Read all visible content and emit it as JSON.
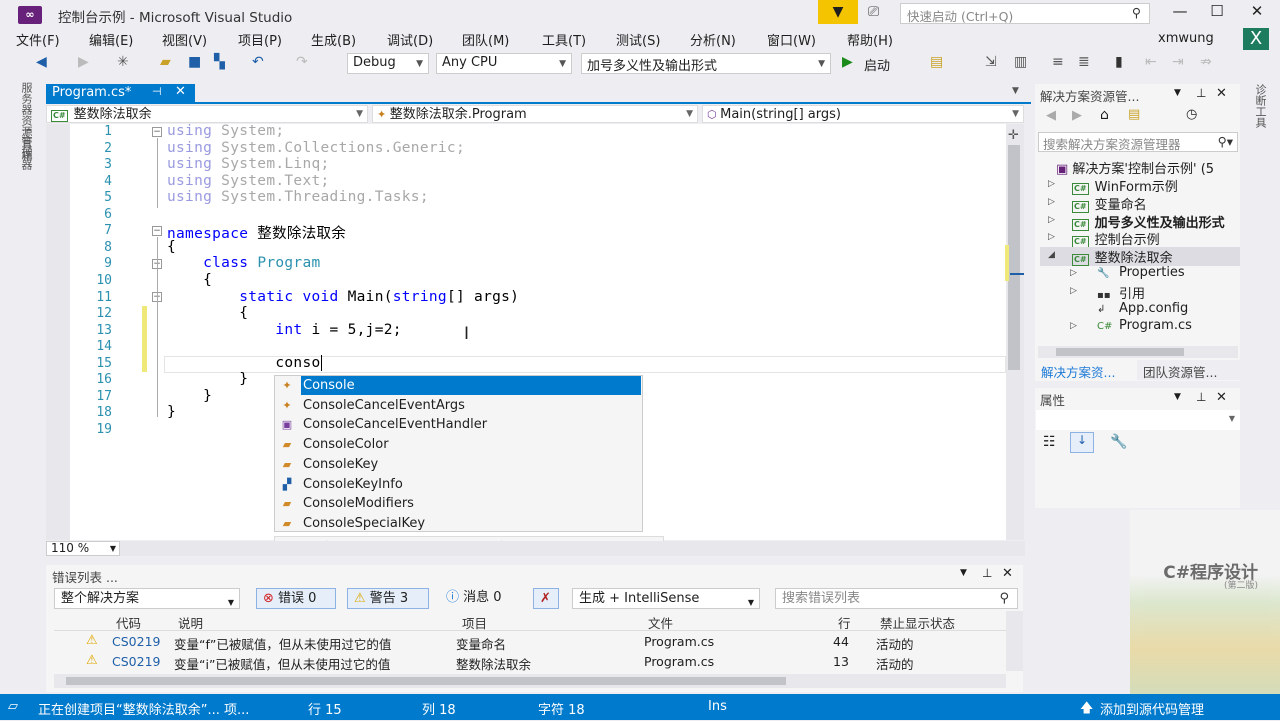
{
  "window": {
    "title": "控制台示例 - Microsoft Visual Studio",
    "quick_launch_placeholder": "快速启动 (Ctrl+Q)",
    "user": "xmwung",
    "minimize": "—",
    "maximize": "☐",
    "close": "✕"
  },
  "menu": [
    "文件(F)",
    "编辑(E)",
    "视图(V)",
    "项目(P)",
    "生成(B)",
    "调试(D)",
    "团队(M)",
    "工具(T)",
    "测试(S)",
    "分析(N)",
    "窗口(W)",
    "帮助(H)"
  ],
  "toolbar": {
    "config": "Debug",
    "platform": "Any CPU",
    "startup_project": "加号多义性及输出形式",
    "start_label": "启动"
  },
  "left_strip": [
    "服务器资源管理器",
    "工具箱"
  ],
  "right_strip": "诊断工具",
  "editor": {
    "tab_label": "Program.cs*",
    "nav_project": "整数除法取余",
    "nav_class": "整数除法取余.Program",
    "nav_member": "Main(string[] args)",
    "zoom": "110 %",
    "lines": [
      {
        "n": "1",
        "t": "using System;"
      },
      {
        "n": "2",
        "t": "using System.Collections.Generic;"
      },
      {
        "n": "3",
        "t": "using System.Linq;"
      },
      {
        "n": "4",
        "t": "using System.Text;"
      },
      {
        "n": "5",
        "t": "using System.Threading.Tasks;"
      },
      {
        "n": "6",
        "t": ""
      },
      {
        "n": "7",
        "t": "namespace 整数除法取余"
      },
      {
        "n": "8",
        "t": "{"
      },
      {
        "n": "9",
        "t": "    class Program"
      },
      {
        "n": "10",
        "t": "    {"
      },
      {
        "n": "11",
        "t": "        static void Main(string[] args)"
      },
      {
        "n": "12",
        "t": "        {"
      },
      {
        "n": "13",
        "t": "            int i = 5,j=2;"
      },
      {
        "n": "14",
        "t": ""
      },
      {
        "n": "15",
        "t": "            conso"
      },
      {
        "n": "16",
        "t": "        }"
      },
      {
        "n": "17",
        "t": "    }"
      },
      {
        "n": "18",
        "t": "}"
      },
      {
        "n": "19",
        "t": ""
      }
    ]
  },
  "autocomplete": {
    "items": [
      {
        "label": "Console",
        "icon": "class-icon",
        "selected": true
      },
      {
        "label": "ConsoleCancelEventArgs",
        "icon": "class-icon"
      },
      {
        "label": "ConsoleCancelEventHandler",
        "icon": "delegate-icon"
      },
      {
        "label": "ConsoleColor",
        "icon": "enum-icon"
      },
      {
        "label": "ConsoleKey",
        "icon": "enum-icon"
      },
      {
        "label": "ConsoleKeyInfo",
        "icon": "struct-icon"
      },
      {
        "label": "ConsoleModifiers",
        "icon": "enum-icon"
      },
      {
        "label": "ConsoleSpecialKey",
        "icon": "enum-icon"
      }
    ],
    "filter_icons": [
      "[▪]",
      "⬡",
      "⊷",
      "⬙",
      "▰",
      "⬘",
      "⬢",
      "{}",
      "☰",
      "☐"
    ]
  },
  "error_list": {
    "title": "错误列表 ...",
    "scope": "整个解决方案",
    "errors": "错误 0",
    "warnings": "警告 3",
    "messages": "消息 0",
    "build_filter": "生成 + IntelliSense",
    "search_placeholder": "搜索错误列表",
    "columns": [
      "代码",
      "说明",
      "项目",
      "文件",
      "行",
      "禁止显示状态"
    ],
    "rows": [
      {
        "code": "CS0219",
        "desc": "变量“f”已被赋值，但从未使用过它的值",
        "project": "变量命名",
        "file": "Program.cs",
        "line": "44",
        "state": "活动的"
      },
      {
        "code": "CS0219",
        "desc": "变量“i”已被赋值，但从未使用过它的值",
        "project": "整数除法取余",
        "file": "Program.cs",
        "line": "13",
        "state": "活动的"
      }
    ]
  },
  "solution_explorer": {
    "title": "解决方案资源管...",
    "search_placeholder": "搜索解决方案资源管理器",
    "solution": "解决方案'控制台示例' (5",
    "projects": [
      "WinForm示例",
      "变量命名",
      "加号多义性及输出形式",
      "控制台示例",
      "整数除法取余"
    ],
    "children": [
      "Properties",
      "引用",
      "App.config",
      "Program.cs"
    ],
    "tab_active": "解决方案资...",
    "tab_other": "团队资源管..."
  },
  "properties": {
    "title": "属性"
  },
  "status": {
    "message": "正在创建项目“整数除法取余”... 项...",
    "line": "行 15",
    "col": "列 18",
    "char": "字符 18",
    "mode": "Ins",
    "source_control": "添加到源代码管理"
  },
  "book": {
    "title": "C#程序设计",
    "edition": "(第二版)"
  },
  "colors": {
    "accent": "#007acc",
    "keyword": "#0000ff",
    "type": "#2b91af",
    "warning": "#f5c400"
  }
}
